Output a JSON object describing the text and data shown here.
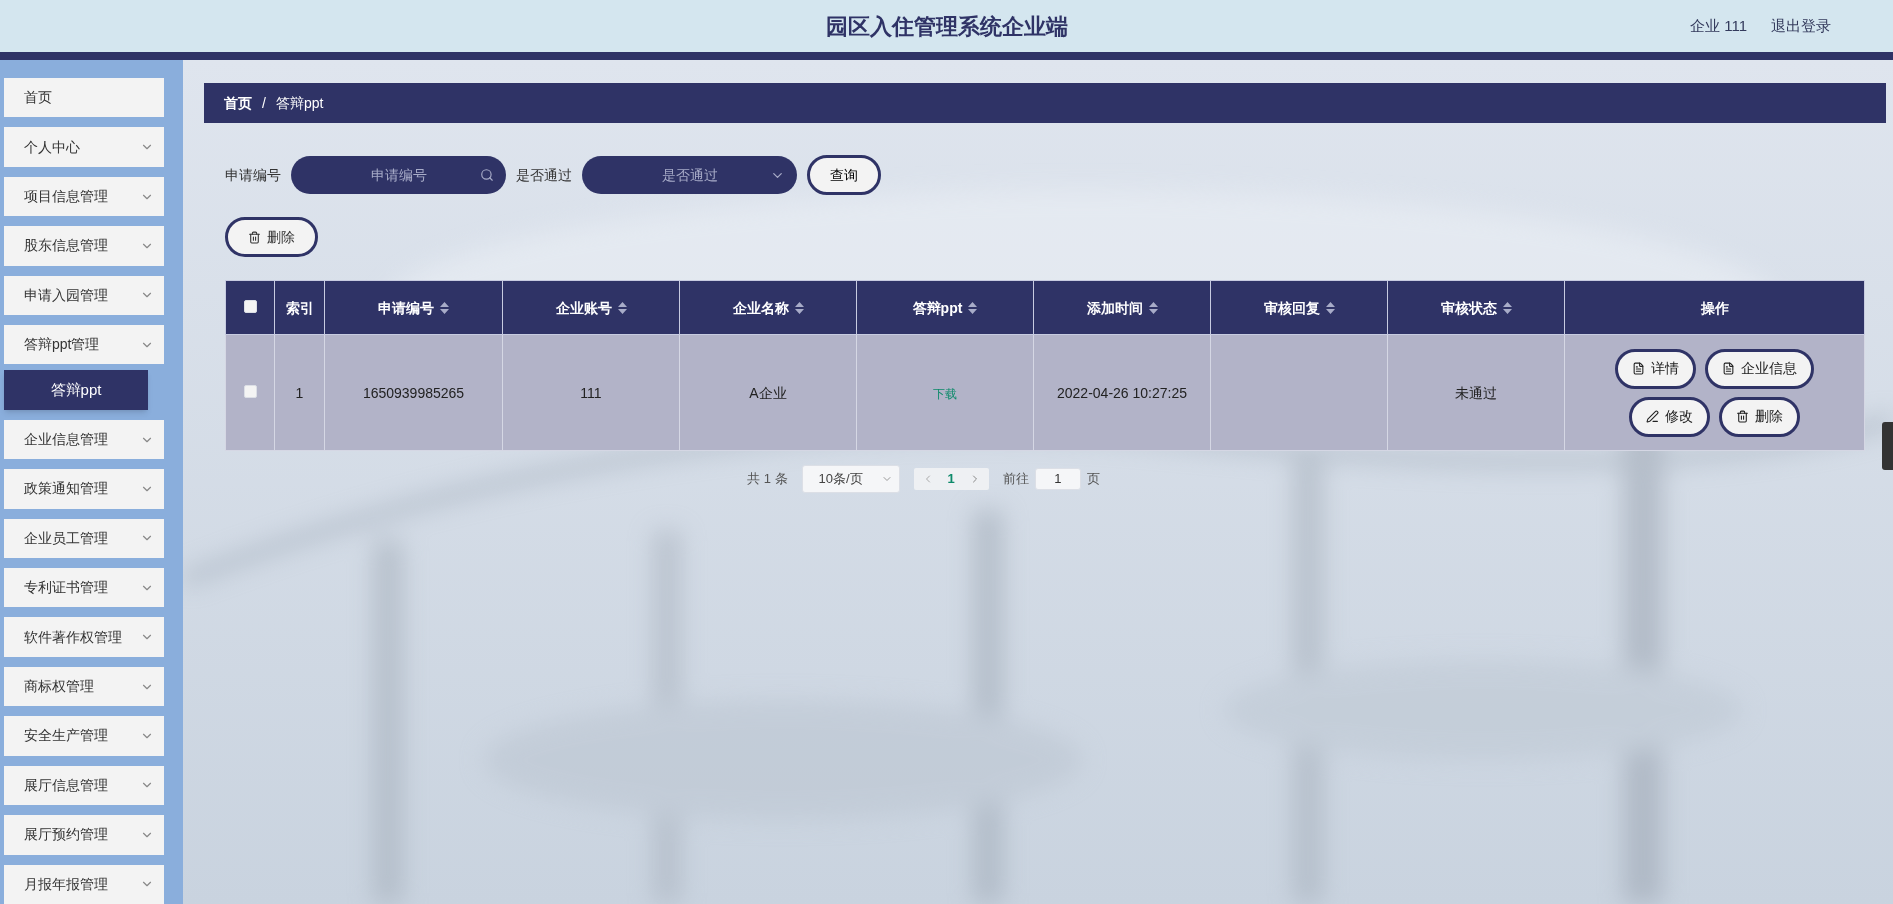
{
  "header": {
    "title": "园区入住管理系统企业端",
    "user": "企业 111",
    "logout": "退出登录"
  },
  "sidebar": {
    "items": [
      {
        "label": "首页",
        "has_children": false
      },
      {
        "label": "个人中心",
        "has_children": true
      },
      {
        "label": "项目信息管理",
        "has_children": true
      },
      {
        "label": "股东信息管理",
        "has_children": true
      },
      {
        "label": "申请入园管理",
        "has_children": true
      },
      {
        "label": "答辩ppt管理",
        "has_children": true,
        "children": [
          {
            "label": "答辩ppt",
            "selected": true
          }
        ]
      },
      {
        "label": "企业信息管理",
        "has_children": true
      },
      {
        "label": "政策通知管理",
        "has_children": true
      },
      {
        "label": "企业员工管理",
        "has_children": true
      },
      {
        "label": "专利证书管理",
        "has_children": true
      },
      {
        "label": "软件著作权管理",
        "has_children": true
      },
      {
        "label": "商标权管理",
        "has_children": true
      },
      {
        "label": "安全生产管理",
        "has_children": true
      },
      {
        "label": "展厅信息管理",
        "has_children": true
      },
      {
        "label": "展厅预约管理",
        "has_children": true
      },
      {
        "label": "月报年报管理",
        "has_children": true
      }
    ]
  },
  "breadcrumb": [
    "首页",
    "/",
    "答辩ppt"
  ],
  "search": {
    "fields": [
      {
        "label": "申请编号",
        "placeholder": "申请编号",
        "kind": "text"
      },
      {
        "label": "是否通过",
        "placeholder": "是否通过",
        "kind": "select"
      }
    ],
    "button": "查询"
  },
  "delete_button": "删除",
  "table": {
    "select_all_checked": false,
    "columns": [
      {
        "label": "索引",
        "sortable": false
      },
      {
        "label": "申请编号",
        "sortable": true
      },
      {
        "label": "企业账号",
        "sortable": true
      },
      {
        "label": "企业名称",
        "sortable": true
      },
      {
        "label": "答辩ppt",
        "sortable": true
      },
      {
        "label": "添加时间",
        "sortable": true
      },
      {
        "label": "审核回复",
        "sortable": true
      },
      {
        "label": "审核状态",
        "sortable": true
      },
      {
        "label": "操作",
        "sortable": false
      }
    ],
    "rows": [
      {
        "checked": false,
        "cells": [
          "1",
          "1650939985265",
          "111",
          "A企业",
          "下载",
          "2022-04-26 10:27:25",
          "",
          "未通过"
        ],
        "actions": [
          {
            "label": "详情",
            "kind": "doc"
          },
          {
            "label": "企业信息",
            "kind": "doc"
          },
          {
            "label": "修改",
            "kind": "edit"
          },
          {
            "label": "删除",
            "kind": "delete"
          }
        ]
      }
    ]
  },
  "pagination": {
    "total": "共 1 条",
    "page_size": "10条/页",
    "pages": [
      {
        "label": "1",
        "selected": true
      }
    ],
    "goto_label": "前往",
    "goto_value": "1",
    "page_suffix": "页"
  }
}
